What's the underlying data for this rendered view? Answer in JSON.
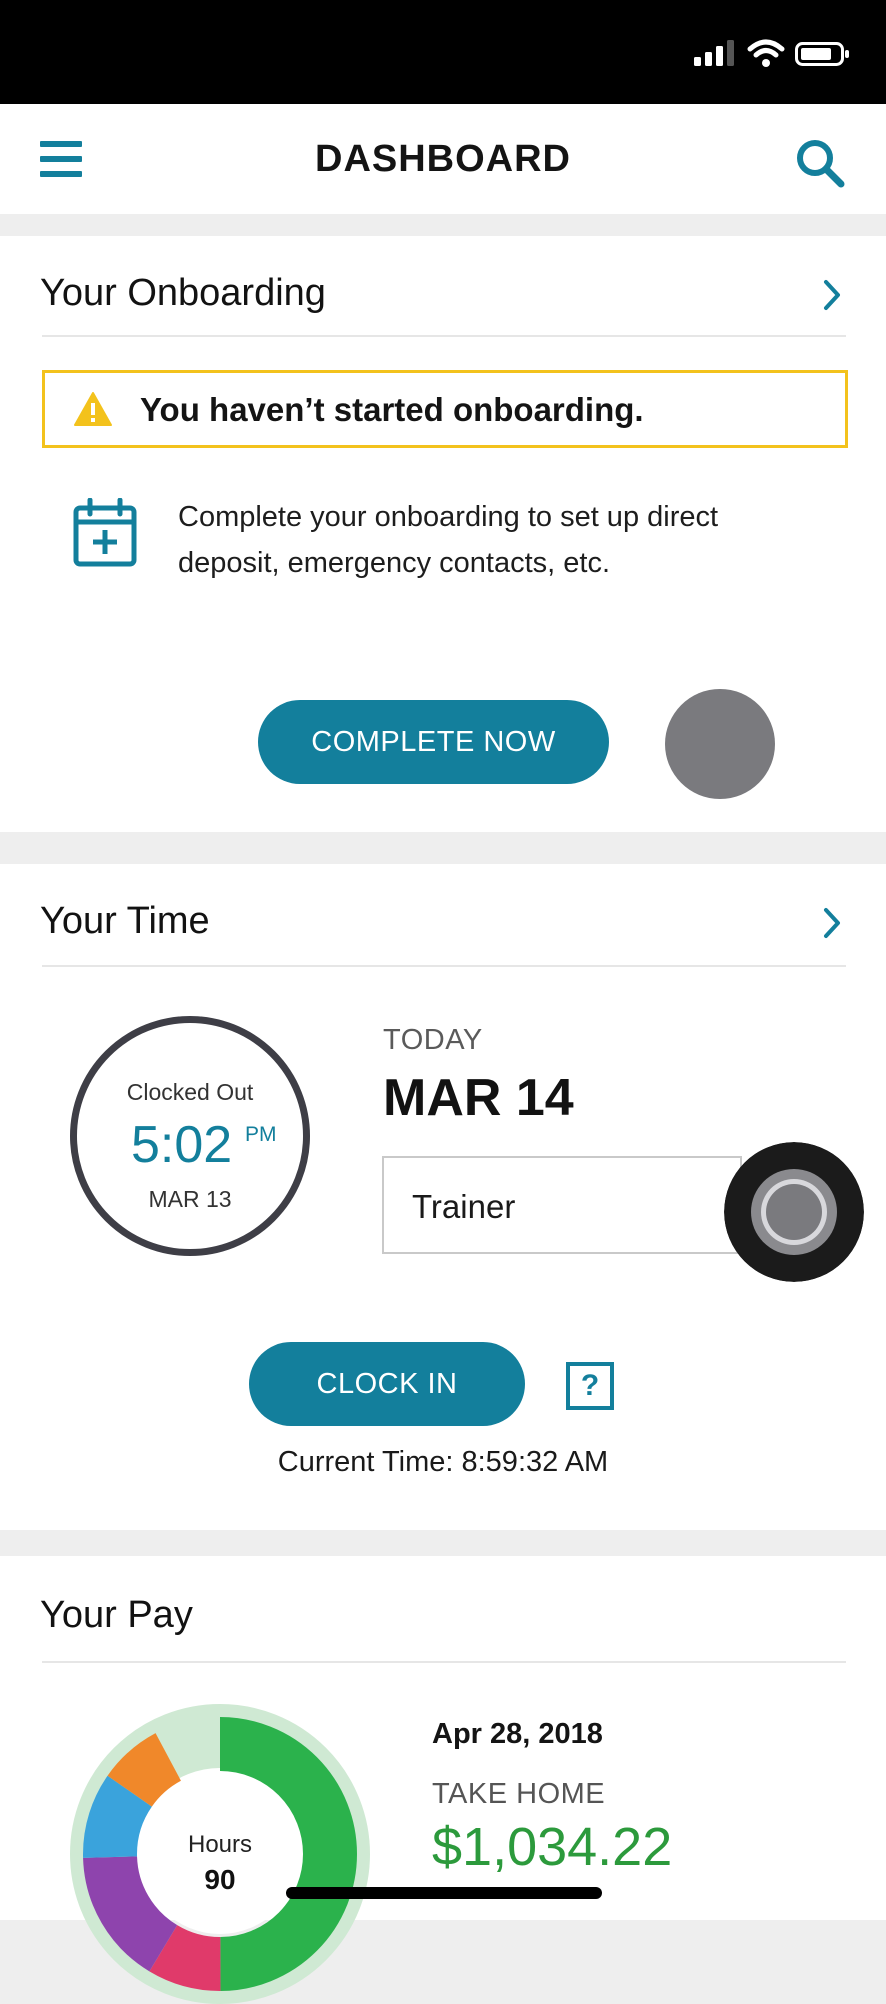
{
  "nav": {
    "title": "DASHBOARD"
  },
  "onboarding": {
    "heading": "Your Onboarding",
    "warning": "You haven’t started onboarding.",
    "description": "Complete your onboarding to set up direct deposit, emergency contacts, etc.",
    "button": "COMPLETE NOW"
  },
  "time": {
    "heading": "Your Time",
    "status": "Clocked Out",
    "clock_time": "5:02",
    "clock_ampm": "PM",
    "clock_date": "MAR 13",
    "today_label": "TODAY",
    "today_date": "MAR 14",
    "job": "Trainer",
    "button": "CLOCK IN",
    "help": "?",
    "current_time": "Current Time: 8:59:32 AM"
  },
  "pay": {
    "heading": "Your Pay",
    "date": "Apr 28, 2018",
    "label": "TAKE HOME",
    "amount": "$1,034.22",
    "hours_label": "Hours",
    "hours_value": "90"
  },
  "colors": {
    "accent": "#137f9c",
    "warning": "#f3c21c",
    "money": "#2c9a3c"
  },
  "icons": [
    "signal-icon",
    "wifi-icon",
    "battery-icon",
    "menu-icon",
    "search-icon",
    "chevron-right-icon",
    "warning-icon",
    "calendar-add-icon",
    "help-icon"
  ]
}
